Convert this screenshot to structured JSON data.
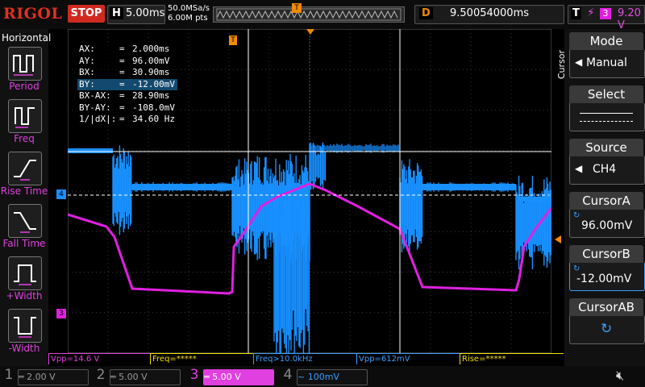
{
  "brand": "RIGOL",
  "run_state": "STOP",
  "timebase": {
    "label": "H",
    "value": "5.00ms",
    "sample_rate": "50.0MSa/s",
    "memory_depth": "6.00M pts"
  },
  "delay": {
    "label": "D",
    "value": "9.50054000ms"
  },
  "trigger": {
    "label": "T",
    "edge_icon": "rising-edge",
    "source": "3",
    "level": "9.20 V"
  },
  "left_menu": {
    "title": "Horizontal",
    "items": [
      {
        "label": "Period",
        "icon": "period-icon"
      },
      {
        "label": "Freq",
        "icon": "frequency-icon"
      },
      {
        "label": "Rise Time",
        "icon": "rise-time-icon"
      },
      {
        "label": "Fall Time",
        "icon": "fall-time-icon"
      },
      {
        "label": "+Width",
        "icon": "positive-width-icon"
      },
      {
        "label": "-Width",
        "icon": "negative-width-icon"
      }
    ]
  },
  "right_menu": {
    "title": "Cursor",
    "items": [
      {
        "title": "Mode",
        "value": "Manual",
        "arrow": true
      },
      {
        "title": "Select",
        "value": ""
      },
      {
        "title": "Source",
        "value": "CH4",
        "arrow": true
      },
      {
        "title": "CursorA",
        "value": "96.00mV",
        "knob": true
      },
      {
        "title": "CursorB",
        "value": "-12.00mV",
        "knob": true,
        "selected": true
      },
      {
        "title": "CursorAB",
        "value": "",
        "knob": true
      }
    ]
  },
  "measurements": [
    {
      "key": "AX:",
      "eq": "=",
      "value": "2.000ms"
    },
    {
      "key": "AY:",
      "eq": "=",
      "value": "96.00mV"
    },
    {
      "key": "BX:",
      "eq": "=",
      "value": "30.90ms"
    },
    {
      "key": "BY:",
      "eq": "=",
      "value": "-12.00mV",
      "highlight": true
    },
    {
      "key": "BX-AX:",
      "eq": "=",
      "value": "28.90ms"
    },
    {
      "key": "BY-AY:",
      "eq": "=",
      "value": "-108.0mV"
    },
    {
      "key": "1/|dX|:",
      "eq": "=",
      "value": "34.60 Hz"
    }
  ],
  "markers": {
    "ch4_offset": "4",
    "ch3_offset": "3",
    "trigger_pos": "T"
  },
  "status_items": [
    {
      "text": "Vpp=14.6 V",
      "color": "#e040e0"
    },
    {
      "text": "Freq=*****",
      "color": "#f0e000"
    },
    {
      "text": "Freq>10.0kHz",
      "color": "#3aa0ff"
    },
    {
      "text": "Vpp=612mV",
      "color": "#3aa0ff"
    },
    {
      "text": "Rise=*****",
      "color": "#f0e000"
    }
  ],
  "channels": [
    {
      "num": "1",
      "coupling": "═",
      "scale": "2.00 V",
      "color": "#f0e000",
      "active": false
    },
    {
      "num": "2",
      "coupling": "═",
      "scale": "5.00 V",
      "color": "#1ec8e0",
      "active": false
    },
    {
      "num": "3",
      "coupling": "═",
      "scale": "5.00 V",
      "color": "#e040e0",
      "active": true
    },
    {
      "num": "4",
      "coupling": "~",
      "scale": "100mV",
      "color": "#3aa0ff",
      "active": false
    }
  ],
  "colors": {
    "ch3": "#e020e0",
    "ch4": "#1890ff",
    "cursor": "#ffffff",
    "accent_orange": "#f08a00"
  }
}
